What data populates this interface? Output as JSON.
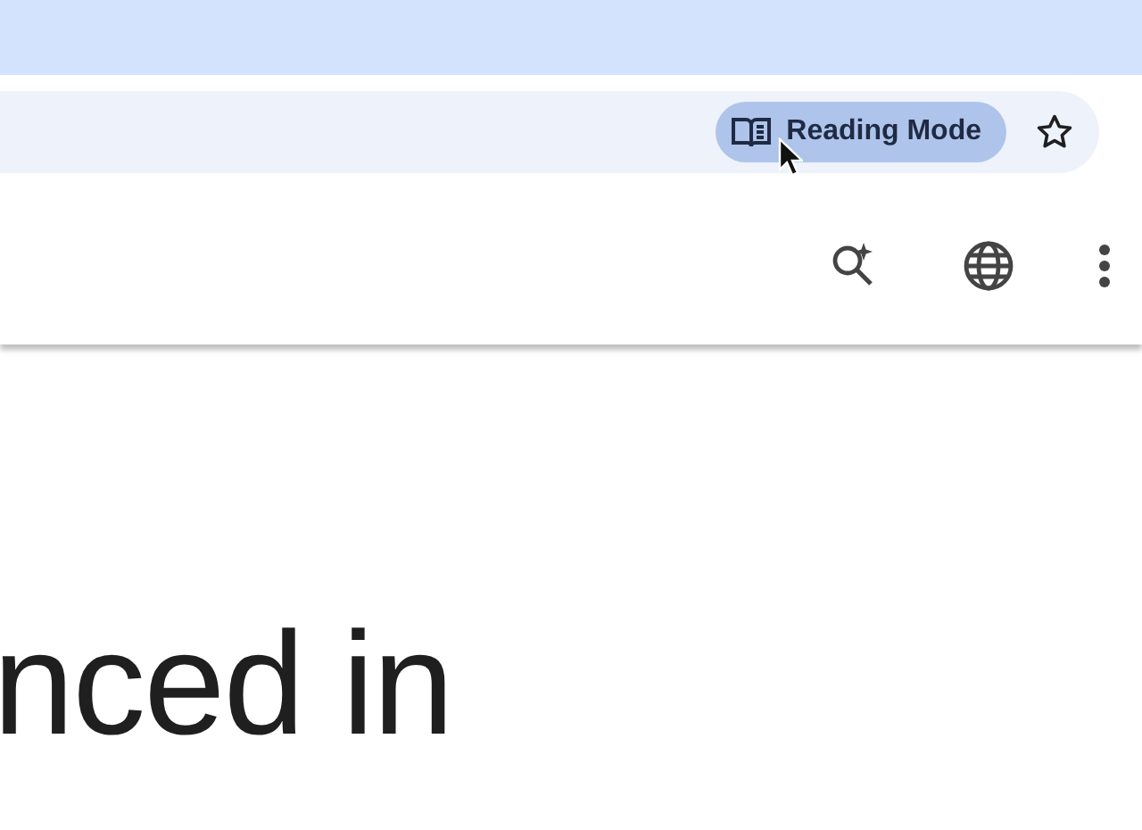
{
  "address_bar": {
    "reading_mode_chip": {
      "label": "Reading Mode",
      "highlighted": true
    },
    "bookmarked": false
  },
  "page": {
    "heading": "nced in"
  }
}
